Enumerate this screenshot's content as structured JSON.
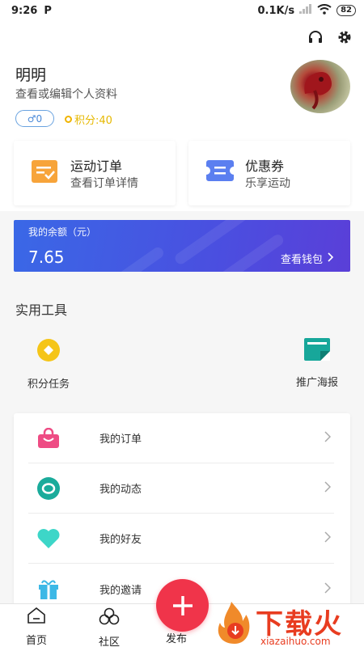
{
  "status_bar": {
    "time": "9:26",
    "app_icon": "P",
    "network_speed": "0.1K/s",
    "battery": "82"
  },
  "header": {
    "username": "明明",
    "edit_profile": "查看或编辑个人资料",
    "gender_badge": "♂0",
    "points": "积分:40"
  },
  "cards": [
    {
      "title": "运动订单",
      "subtitle": "查看订单详情",
      "icon": "order-icon",
      "color": "#f7a43a"
    },
    {
      "title": "优惠券",
      "subtitle": "乐享运动",
      "icon": "coupon-icon",
      "color": "#5b7ff0"
    }
  ],
  "balance": {
    "label": "我的余额（元）",
    "amount": "7.65",
    "wallet_link": "查看钱包"
  },
  "tools": {
    "section_title": "实用工具",
    "items": [
      {
        "label": "积分任务",
        "icon": "points-task-icon",
        "color": "#f5c518"
      },
      {
        "label": "推广海报",
        "icon": "poster-icon",
        "color": "#17a79a"
      }
    ]
  },
  "menu": [
    {
      "label": "我的订单",
      "icon": "shopping-bag-icon",
      "color": "#ee4c84"
    },
    {
      "label": "我的动态",
      "icon": "moments-icon",
      "color": "#1aab9b"
    },
    {
      "label": "我的好友",
      "icon": "heart-icon",
      "color": "#3dd6c8"
    },
    {
      "label": "我的邀请",
      "icon": "gift-icon",
      "color": "#3cb8e6"
    }
  ],
  "bottom_nav": {
    "home": "首页",
    "community": "社区",
    "publish": "发布"
  },
  "watermark": {
    "text": "下载火",
    "domain": "xiazaihuo.com"
  },
  "colors": {
    "accent_red": "#f0344a",
    "balance_blue": "#3a68e6",
    "points_gold": "#e6b800"
  }
}
